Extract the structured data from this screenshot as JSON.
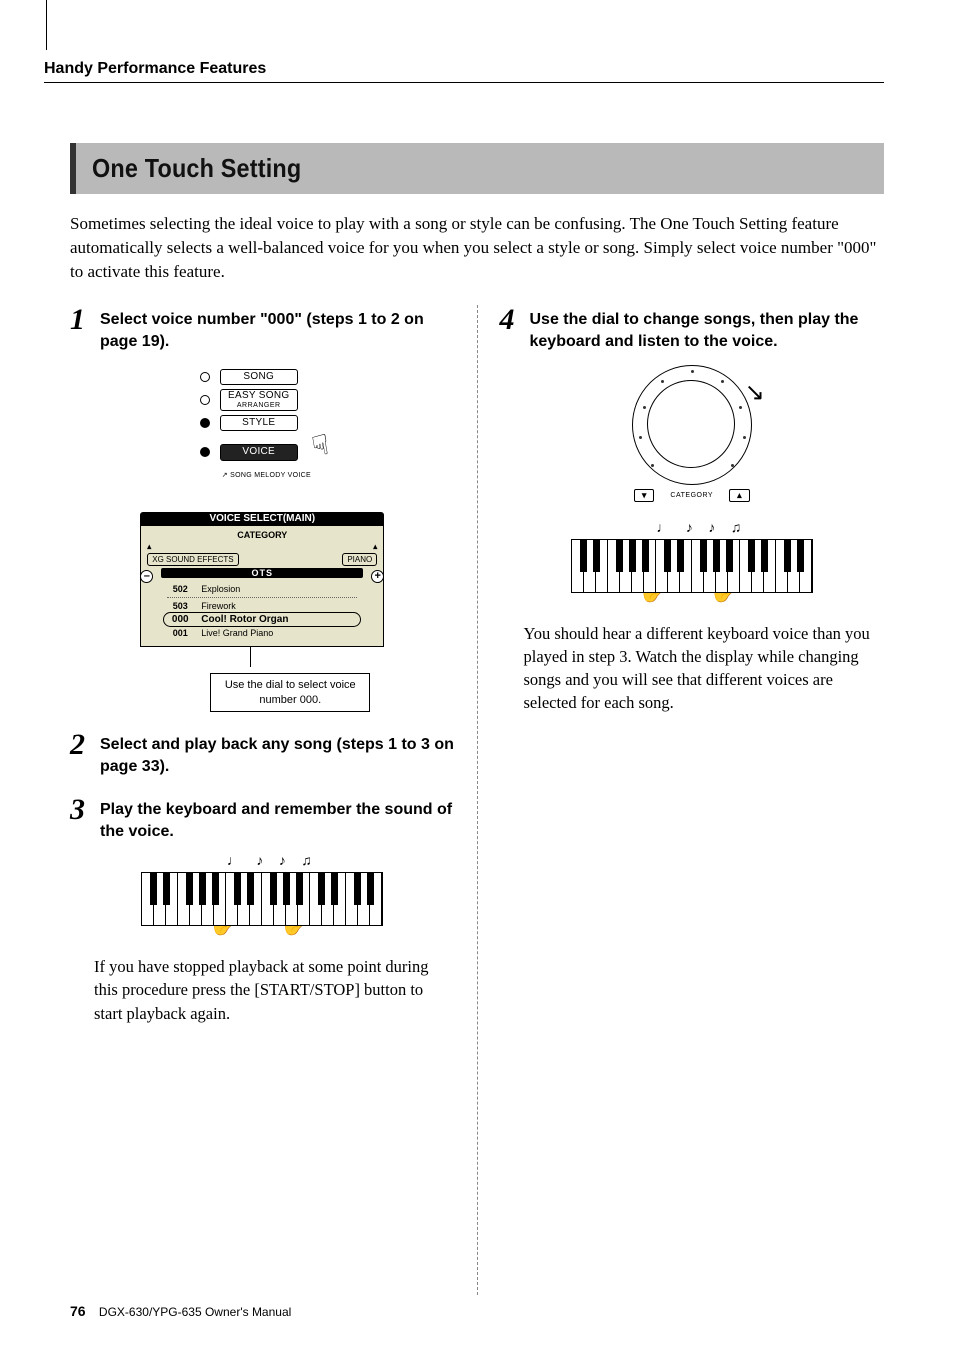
{
  "header": "Handy Performance Features",
  "section_title": "One Touch Setting",
  "intro": "Sometimes selecting the ideal voice to play with a song or style can be confusing. The One Touch Setting feature automatically selects a well-balanced voice for you when you select a style or song. Simply select voice number \"000\" to activate this feature.",
  "steps": {
    "s1": {
      "num": "1",
      "title": "Select voice number \"000\" (steps 1 to 2 on page 19)."
    },
    "s2": {
      "num": "2",
      "title": "Select and play back any song (steps 1 to 3 on page 33)."
    },
    "s3": {
      "num": "3",
      "title": "Play the keyboard and remember the sound of the voice.",
      "body": "If you have stopped playback at some point during this procedure press the [START/STOP] button to start playback again."
    },
    "s4": {
      "num": "4",
      "title": "Use the dial to change songs, then play the keyboard and listen to the voice.",
      "body": "You should hear a different keyboard voice than you played in step 3. Watch the display while changing songs and you will see that different voices are selected for each song."
    }
  },
  "panel": {
    "btn_song": "SONG",
    "btn_easy_top": "EASY SONG",
    "btn_easy_bot": "ARRANGER",
    "btn_style": "STYLE",
    "btn_voice": "VOICE",
    "melody_label": "SONG MELODY VOICE"
  },
  "lcd": {
    "title": "VOICE SELECT(MAIN)",
    "category_label": "CATEGORY",
    "cat_left": "XG SOUND EFFECTS",
    "cat_right": "PIANO",
    "ots": "OTS",
    "rows": [
      {
        "n": "502",
        "name": "Explosion"
      },
      {
        "n": "503",
        "name": "Firework"
      }
    ],
    "sel": {
      "n": "000",
      "name": "Cool! Rotor Organ"
    },
    "after": {
      "n": "001",
      "name": "Live! Grand Piano"
    },
    "minus": "–",
    "plus": "+",
    "caption": "Use the dial to select voice number 000."
  },
  "dial": {
    "cat_label": "CATEGORY",
    "down": "▾",
    "up": "▴"
  },
  "notes_glyphs": "♩  ♪   ♪  ♫",
  "footer": {
    "page": "76",
    "manual": "DGX-630/YPG-635  Owner's Manual"
  }
}
